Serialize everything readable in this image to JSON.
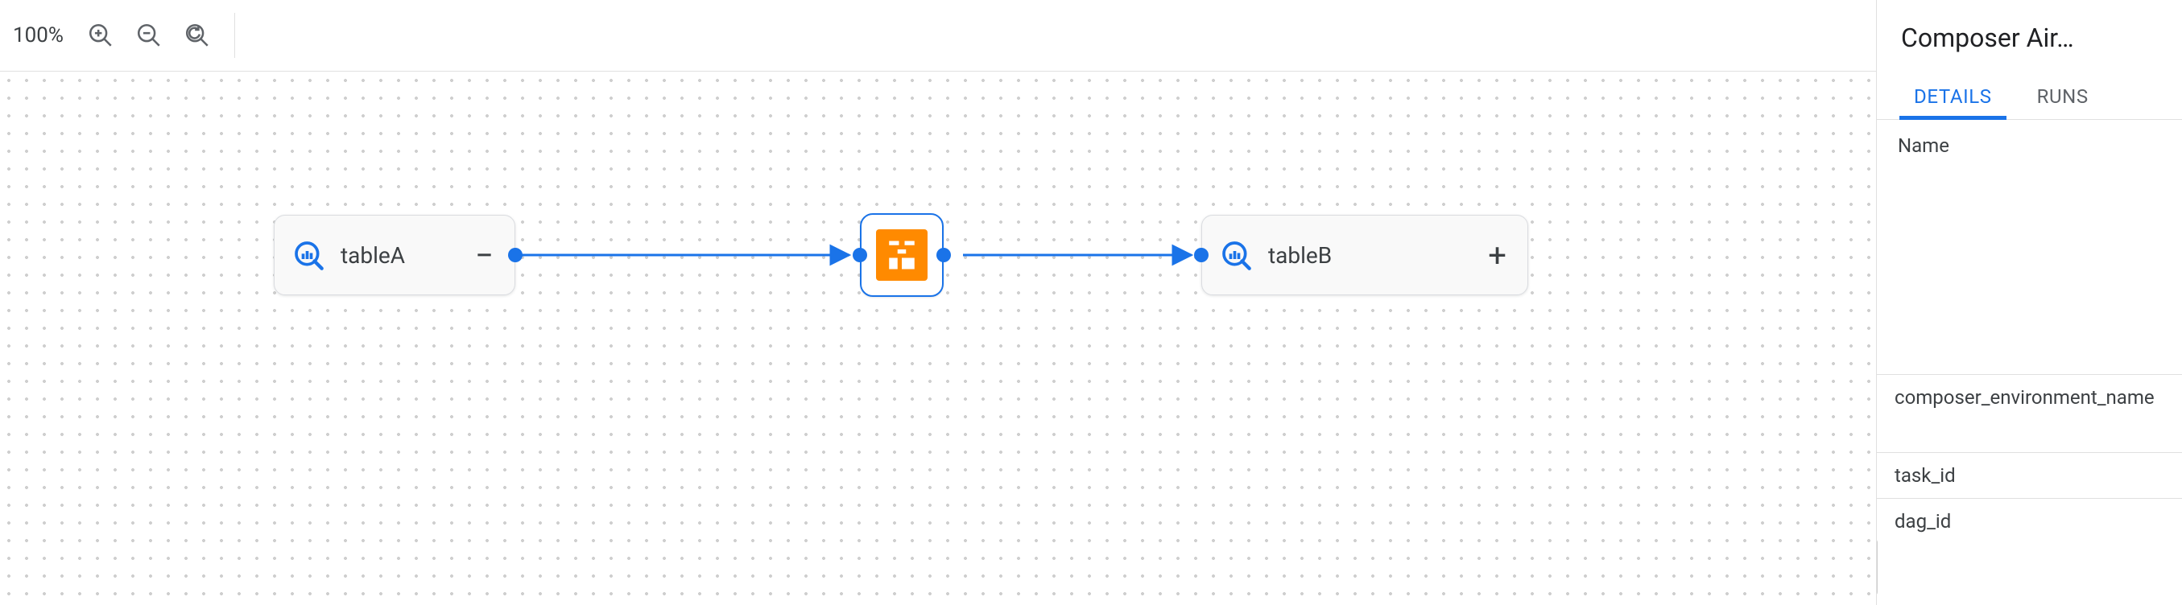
{
  "toolbar": {
    "zoom_label": "100%"
  },
  "canvas": {
    "nodes": {
      "tableA": {
        "label": "tableA",
        "expand_symbol": "−"
      },
      "tableB": {
        "label": "tableB",
        "expand_symbol": "+"
      }
    }
  },
  "sidepanel": {
    "title": "Composer Air…",
    "tabs": {
      "details": "DETAILS",
      "runs": "RUNS",
      "active": "details"
    },
    "name_label": "Name",
    "fields": {
      "env": "composer_environment_name",
      "task": "task_id",
      "dag": "dag_id"
    }
  }
}
